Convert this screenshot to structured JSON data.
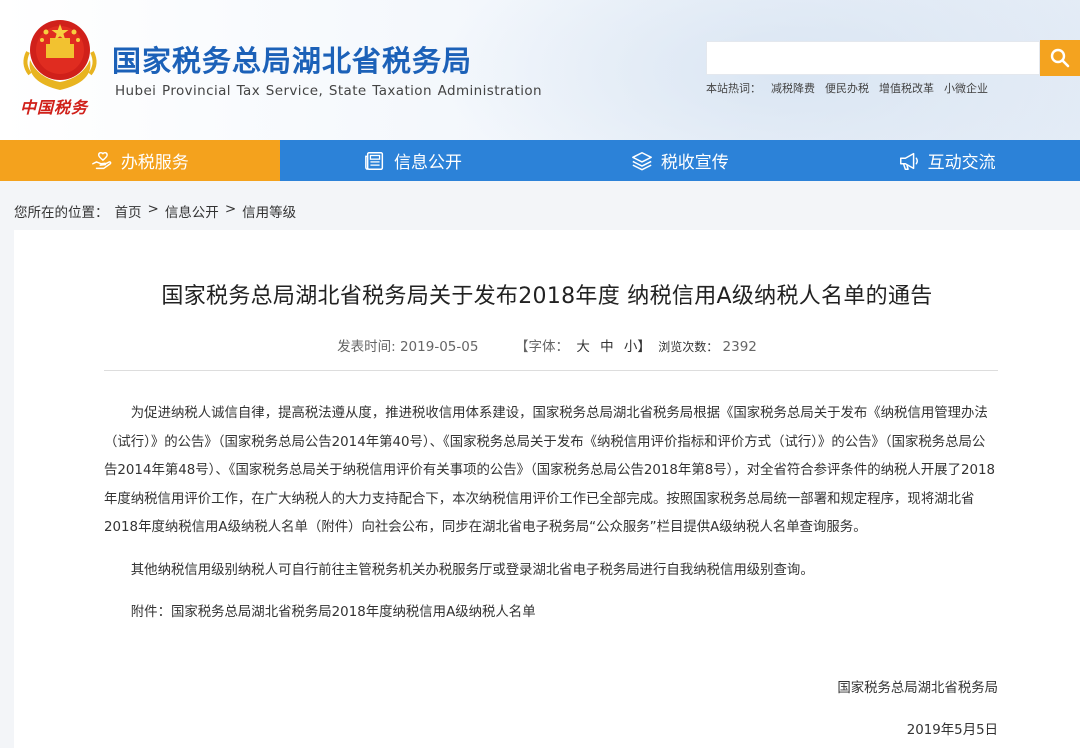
{
  "header": {
    "logo_script": "中国税务",
    "title": "国家税务总局湖北省税务局",
    "subtitle": "Hubei Provincial Tax Service, State Taxation Administration",
    "search": {
      "placeholder": ""
    },
    "hot_label": "本站热词：",
    "hot_words": [
      "减税降费",
      "便民办税",
      "增值税改革",
      "小微企业"
    ]
  },
  "nav": {
    "items": [
      {
        "label": "办税服务",
        "icon": "hand-heart-icon",
        "active": true
      },
      {
        "label": "信息公开",
        "icon": "newspaper-icon",
        "active": false
      },
      {
        "label": "税收宣传",
        "icon": "layers-icon",
        "active": false
      },
      {
        "label": "互动交流",
        "icon": "megaphone-icon",
        "active": false
      }
    ]
  },
  "breadcrumb": {
    "prefix": "您所在的位置：",
    "items": [
      "首页",
      "信息公开",
      "信用等级"
    ],
    "separator": ">"
  },
  "article": {
    "title": "国家税务总局湖北省税务局关于发布2018年度 纳税信用A级纳税人名单的通告",
    "publish_label": "发表时间:",
    "publish_date": "2019-05-05",
    "font_label": "【字体：",
    "font_large": "大",
    "font_medium": "中",
    "font_small": "小】",
    "views_label": "浏览次数：",
    "views": "2392",
    "paragraphs": [
      "为促进纳税人诚信自律，提高税法遵从度，推进税收信用体系建设，国家税务总局湖北省税务局根据《国家税务总局关于发布《纳税信用管理办法（试行）》的公告》（国家税务总局公告2014年第40号）、《国家税务总局关于发布《纳税信用评价指标和评价方式（试行）》的公告》（国家税务总局公告2014年第48号）、《国家税务总局关于纳税信用评价有关事项的公告》（国家税务总局公告2018年第8号），对全省符合参评条件的纳税人开展了2018年度纳税信用评价工作，在广大纳税人的大力支持配合下，本次纳税信用评价工作已全部完成。按照国家税务总局统一部署和规定程序，现将湖北省2018年度纳税信用A级纳税人名单（附件）向社会公布，同步在湖北省电子税务局“公众服务”栏目提供A级纳税人名单查询服务。",
      "其他纳税信用级别纳税人可自行前往主管税务机关办税服务厅或登录湖北省电子税务局进行自我纳税信用级别查询。",
      "附件：国家税务总局湖北省税务局2018年度纳税信用A级纳税人名单"
    ],
    "signature": "国家税务总局湖北省税务局",
    "sign_date": "2019年5月5日"
  },
  "colors": {
    "brand_blue": "#1c61b8",
    "nav_blue": "#2c82d8",
    "nav_active_orange": "#f4a21d",
    "search_button": "#f4a31f",
    "emblem_red": "#d0201a"
  }
}
